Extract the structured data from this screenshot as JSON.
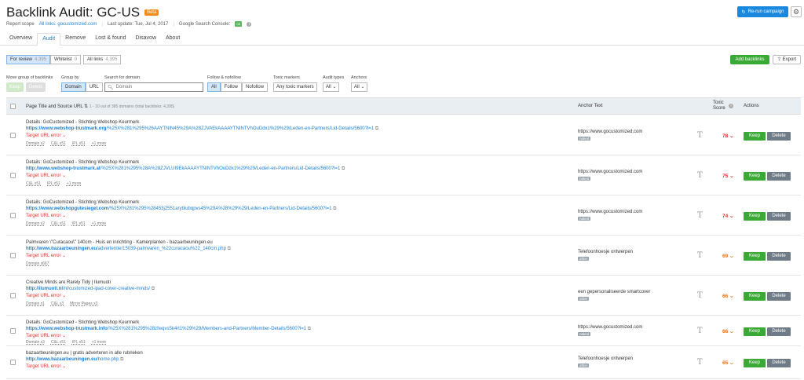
{
  "header": {
    "title": "Backlink Audit: GC-US",
    "beta": "Beta",
    "report_scope_label": "Report scope",
    "report_scope_value": "All links: gocustomized.com",
    "last_update": "Last update: Tue, Jul 4, 2017",
    "console_label": "Google Search Console:",
    "console_badge": "on",
    "rerun": "Re-run campaign"
  },
  "tabs": [
    "Overview",
    "Audit",
    "Remove",
    "Lost & found",
    "Disavow",
    "About"
  ],
  "segments": [
    {
      "label": "For review",
      "count": "4,395"
    },
    {
      "label": "Whitelist",
      "count": "0"
    },
    {
      "label": "All links",
      "count": "4,395"
    }
  ],
  "actions": {
    "add": "Add backlinks",
    "export": "Export"
  },
  "filters": {
    "move_label": "Move group of backlinks",
    "keep": "Keep",
    "delete": "Delete",
    "group_label": "Group by",
    "group_domain": "Domain",
    "group_url": "URL",
    "search_label": "Search for domain",
    "search_placeholder": "Domain",
    "follow_label": "Follow & nofollow",
    "follow_all": "All",
    "follow_follow": "Follow",
    "follow_nofollow": "Nofollow",
    "toxic_label": "Toxic markers",
    "toxic_value": "Any toxic markers",
    "audit_label": "Audit types",
    "audit_value": "All",
    "anchors_label": "Anchors",
    "anchors_value": "All"
  },
  "table": {
    "col_title": "Page Title and Source URL",
    "col_count": "1 - 10 out of 385 domains",
    "col_count_sub": "(total backlinks: 4,395)",
    "col_anchor": "Anchor Text",
    "col_score_1": "Toxic",
    "col_score_2": "Score",
    "col_actions": "Actions",
    "keep": "Keep",
    "delete": "Delete",
    "rows": [
      {
        "title": "Details: GoCustomized - Stichting Webshop Keurmerk",
        "url_bold": "https://www.webshop-trustmark.org",
        "url_rest": "/%25X%281%295%26AAYTNIN45%29A%28ZJVAEkAAAAYTNINTVhOuDdx1%29%29/Leden-en-Partners/Lid-Details/5600?l=1",
        "error": "Target URL error",
        "tags": [
          "Domain x2",
          "C&L x51",
          "IPL x51",
          "+1 more"
        ],
        "anchor": "https://www.gocustomized.com",
        "anchor_badge": "naked",
        "score": "78",
        "color": "#d9372b"
      },
      {
        "title": "Details: GoCustomized - Stichting Webshop Keurmerk",
        "url_bold": "http://www.webshop-trustmark.at",
        "url_rest": "/%25X%281%295%28A%28ZJVLUI9EkAAAAYTNINTVhOuDdx1%29%29/Leden-en-Partners/Lid-Details/5600?l=1",
        "error": "Target URL error",
        "tags": [
          "C&L x51",
          "IPL x51",
          "+1 more"
        ],
        "anchor": "https://www.gocustomized.com",
        "anchor_badge": "naked",
        "score": "75",
        "color": "#d9372b"
      },
      {
        "title": "Details: GoCustomized - Stichting Webshop Keurmerk",
        "url_bold": "https://www.webshopgutesiegel.com",
        "url_rest": "/%25X%281%295%28453j2551aryblubqpvs45%29A%28%29%29/Leden-en-Partners/Lid-Details/5600?l=1",
        "error": "Target URL error",
        "tags": [
          "Domain x2",
          "C&L x51",
          "IPL x51",
          "+1 more"
        ],
        "anchor": "https://www.gocustomized.com",
        "anchor_badge": "naked",
        "score": "74",
        "color": "#d9372b"
      },
      {
        "title": "Palmvaren \\\"Curacaou\\\" 140cm - Huis en inrichting - Kamerplanten - bazaarbeuningen.eu",
        "url_bold": "http://www.bazaarbeuningen.eu",
        "url_rest": "/advertentie/15039-palmvaren_%22curacaou%22_140cm.php",
        "error": "Target URL error",
        "tags": [
          "Domain x667"
        ],
        "anchor": "Telefoonhoesje ontwerpen",
        "anchor_badge": "other",
        "score": "69",
        "color": "#e8731c"
      },
      {
        "title": "Creative Minds are Rarely Tidy | Ilumuoti",
        "url_bold": "http://ilumuoti.nl",
        "url_rest": "/nl/customized-ipad-cover-creative-minds/",
        "error": "Target URL error",
        "tags": [
          "Domain x1",
          "C&L x3",
          "Mirror Pages x3"
        ],
        "anchor": "een gepersonaliseerde smartcover",
        "anchor_badge": "other",
        "score": "66",
        "color": "#e8731c"
      },
      {
        "title": "Details: GoCustomized - Stichting Webshop Keurmerk",
        "url_bold": "https://www.webshop-trustmark.info",
        "url_rest": "/%25X%281%295%28zfwqvs5k4rt1%29%29/Members-and-Partners/Member-Details/5600?l=1",
        "error": "Target URL error",
        "tags": [
          "Domain x3",
          "C&L x51",
          "IPL x51",
          "+1 more"
        ],
        "anchor": "https://www.gocustomized.com",
        "anchor_badge": "naked",
        "score": "66",
        "color": "#e8731c"
      },
      {
        "title": "bazaarbeuningen.eu | gratis adverteren in alle rubrieken",
        "url_bold": "http://www.bazaarbeuningen.eu",
        "url_rest": "/home.php",
        "error": "Target URL error",
        "tags": [],
        "anchor": "Telefoonhoesje ontwerpen",
        "anchor_badge": "other",
        "score": "65",
        "color": "#e8731c"
      }
    ]
  }
}
